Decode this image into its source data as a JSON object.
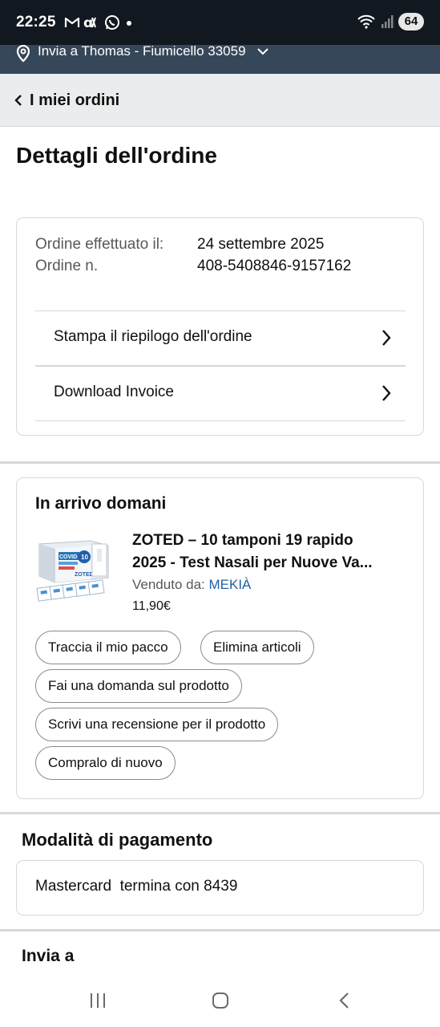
{
  "status_bar": {
    "time": "22:25",
    "battery": "64",
    "icons": [
      "gmail-icon",
      "notification-icon",
      "whatsapp-icon",
      "wifi-icon",
      "signal-icon"
    ]
  },
  "delivery": {
    "text": "Invia a Thomas - Fiumicello 33059"
  },
  "header": {
    "back_label": "I miei ordini"
  },
  "page": {
    "title": "Dettagli dell'ordine"
  },
  "order": {
    "placed_label": "Ordine effettuato il:",
    "placed_value": "24 settembre 2025",
    "number_label": "Ordine n.",
    "number_value": "408-5408846-9157162",
    "links": [
      {
        "label": "Stampa il riepilogo dell'ordine"
      },
      {
        "label": "Download Invoice"
      }
    ]
  },
  "shipment": {
    "title": "In arrivo domani",
    "product": {
      "name_line1": "ZOTED – 10 tamponi 19 rapido",
      "name_line2": "2025 - Test Nasali per Nuove Va...",
      "seller_label": "Venduto da:",
      "seller_name": "MEKIÀ",
      "price": "11,90€",
      "image_text": "COVID-19",
      "image_count": "10",
      "image_brand": "ZOTED"
    },
    "actions": [
      {
        "label": "Traccia il mio pacco"
      },
      {
        "label": "Elimina articoli"
      },
      {
        "label": "Fai una domanda sul prodotto"
      },
      {
        "label": "Scrivi una recensione per il prodotto"
      },
      {
        "label": "Compralo di nuovo"
      }
    ]
  },
  "payment": {
    "title": "Modalità di pagamento",
    "method": "Mastercard  termina con 8439"
  },
  "ship_to": {
    "title": "Invia a"
  },
  "colors": {
    "status_bar": "#111820",
    "delivery_bar": "#37475a",
    "header_bg": "#eaeded",
    "link": "#2162a1",
    "border": "#d5d9d9"
  }
}
